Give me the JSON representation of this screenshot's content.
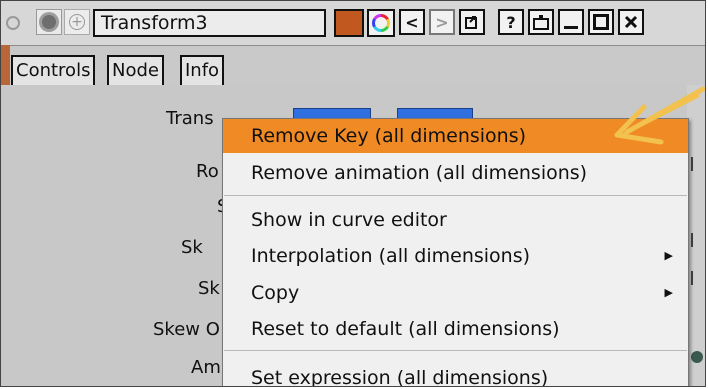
{
  "titlebar": {
    "node_name": "Transform3",
    "icons": [
      "lock-circle-icon",
      "settings-gear-icon",
      "add-circle-icon",
      "color-swatch",
      "color-wheel-icon",
      "previous-icon",
      "next-icon",
      "restore-icon",
      "help-icon",
      "center-node-icon",
      "minimize-icon",
      "maximize-icon",
      "close-icon"
    ],
    "node_color": "#c0581f"
  },
  "tabs": [
    "Controls",
    "Node",
    "Info"
  ],
  "params": {
    "translate": "Trans",
    "rotate": "Ro",
    "scale": "S",
    "skew_x": "Sk",
    "skew_y": "Sk",
    "skew_order": "Skew O",
    "amount": "Am"
  },
  "menu": {
    "items": [
      {
        "label": "Remove Key (all dimensions)",
        "highlighted": true
      },
      {
        "label": "Remove animation (all dimensions)"
      },
      {
        "label": "Show in curve editor"
      },
      {
        "label": "Interpolation (all dimensions)",
        "submenu": true
      },
      {
        "label": "Copy",
        "submenu": true
      },
      {
        "label": "Reset to default (all dimensions)"
      },
      {
        "label": "Set expression (all dimensions)"
      }
    ],
    "submenu_arrow": "▶"
  },
  "colors": {
    "highlight": "#f08a24",
    "annotation_arrow": "#f2c14e",
    "param_field": "#2f6fe0"
  }
}
